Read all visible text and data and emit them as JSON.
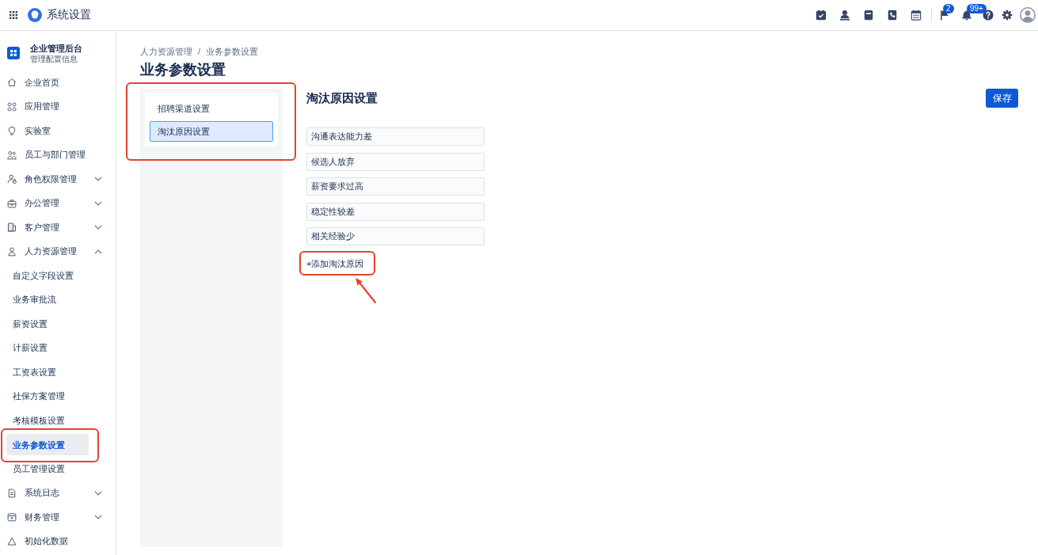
{
  "header": {
    "title": "系统设置",
    "flag_badge": "2",
    "bell_badge": "99+"
  },
  "sidebar": {
    "org_name": "企业管理后台",
    "org_subtitle": "管理配置信息",
    "items": [
      {
        "label": "企业首页",
        "kind": "link",
        "selected": false
      },
      {
        "label": "应用管理",
        "kind": "link",
        "selected": false
      },
      {
        "label": "实验室",
        "kind": "link",
        "selected": false
      },
      {
        "label": "员工与部门管理",
        "kind": "link",
        "selected": false
      },
      {
        "label": "角色权限管理",
        "kind": "group",
        "expanded": false,
        "selected": false
      },
      {
        "label": "办公管理",
        "kind": "group",
        "expanded": false,
        "selected": false
      },
      {
        "label": "客户管理",
        "kind": "group",
        "expanded": false,
        "selected": false
      },
      {
        "label": "人力资源管理",
        "kind": "group",
        "expanded": true,
        "selected": false,
        "children": [
          {
            "label": "自定义字段设置",
            "selected": false,
            "highlighted": false
          },
          {
            "label": "业务审批流",
            "selected": false,
            "highlighted": false
          },
          {
            "label": "薪资设置",
            "selected": false,
            "highlighted": false
          },
          {
            "label": "计薪设置",
            "selected": false,
            "highlighted": false
          },
          {
            "label": "工资表设置",
            "selected": false,
            "highlighted": false
          },
          {
            "label": "社保方案管理",
            "selected": false,
            "highlighted": false
          },
          {
            "label": "考核模板设置",
            "selected": false,
            "highlighted": false
          },
          {
            "label": "业务参数设置",
            "selected": true,
            "highlighted": true
          },
          {
            "label": "员工管理设置",
            "selected": false,
            "highlighted": false
          }
        ]
      },
      {
        "label": "系统日志",
        "kind": "group",
        "expanded": false,
        "selected": false
      },
      {
        "label": "财务管理",
        "kind": "group",
        "expanded": false,
        "selected": false
      },
      {
        "label": "初始化数据",
        "kind": "link",
        "selected": false
      }
    ]
  },
  "breadcrumb": {
    "items": [
      "人力资源管理",
      "业务参数设置"
    ],
    "separator": "/"
  },
  "page_title": "业务参数设置",
  "settings_nav": {
    "highlighted": true,
    "items": [
      {
        "label": "招聘渠道设置",
        "selected": false
      },
      {
        "label": "淘汰原因设置",
        "selected": true
      }
    ]
  },
  "section": {
    "title": "淘汰原因设置",
    "save_button": "保存",
    "reasons": [
      "沟通表达能力差",
      "候选人放弃",
      "薪资要求过高",
      "稳定性较差",
      "相关经验少"
    ],
    "add_link": {
      "label": "+添加淘汰原因",
      "highlighted": true,
      "arrow": true
    }
  }
}
